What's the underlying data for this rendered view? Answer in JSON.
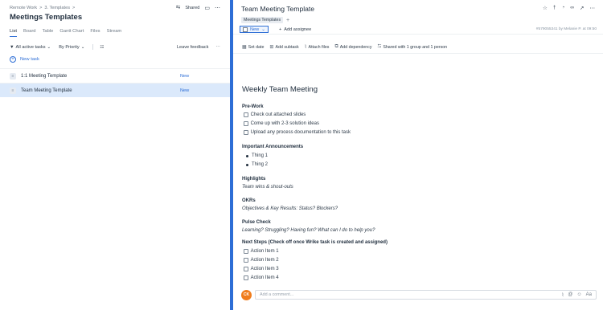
{
  "left": {
    "breadcrumb": [
      "Remote Work",
      ">",
      "3. Templates",
      ">"
    ],
    "title": "Meetings Templates",
    "shared_label": "Shared",
    "views": [
      "List",
      "Board",
      "Table",
      "Gantt Chart",
      "Files",
      "Stream"
    ],
    "active_view": "List",
    "filters": {
      "active": "All active tasks",
      "sort": "By Priority",
      "feedback": "Leave feedback"
    },
    "new_task_label": "New task",
    "tasks": [
      {
        "name": "1:1 Meeting Template",
        "status": "New",
        "selected": false
      },
      {
        "name": "Team Meeting Template",
        "status": "New",
        "selected": true
      }
    ]
  },
  "right": {
    "title": "Team Meeting Template",
    "tag": "Meetings Templates",
    "tag_add": "+",
    "status": "New",
    "add_assignee": "Add assignee",
    "meta": "#579055341 by Melanie P. at 09:50",
    "actions": [
      "Set date",
      "Add subtask",
      "Attach files",
      "Add dependency",
      "Shared with 1 group and 1 person"
    ],
    "doc": {
      "heading": "Weekly Team Meeting",
      "prework_title": "Pre-Work",
      "prework": [
        "Check out attached slides",
        "Come up with 2-3 solution ideas",
        "Upload any process documentation to this task"
      ],
      "announce_title": "Important Announcements",
      "announce": [
        "Thing 1",
        "Thing 2"
      ],
      "highlights_title": "Highlights",
      "highlights_text": "Team wins & shout-outs",
      "okrs_title": "OKRs",
      "okrs_text": "Objectives & Key Results: Status? Blockers?",
      "pulse_title": "Pulse Check",
      "pulse_text": "Learning? Struggling? Having fun? What can I do to help you?",
      "next_title": "Next Steps (Check off once Wrike task is created and assigned)",
      "next": [
        "Action Item 1",
        "Action Item 2",
        "Action Item 3",
        "Action Item 4"
      ]
    },
    "comment": {
      "avatar": "CK",
      "placeholder": "Add a comment...",
      "format_label": "Aa"
    }
  },
  "colors": {
    "accent": "#2d6ed6",
    "selected_row": "#dbe9fb",
    "avatar": "#f07c1c"
  }
}
